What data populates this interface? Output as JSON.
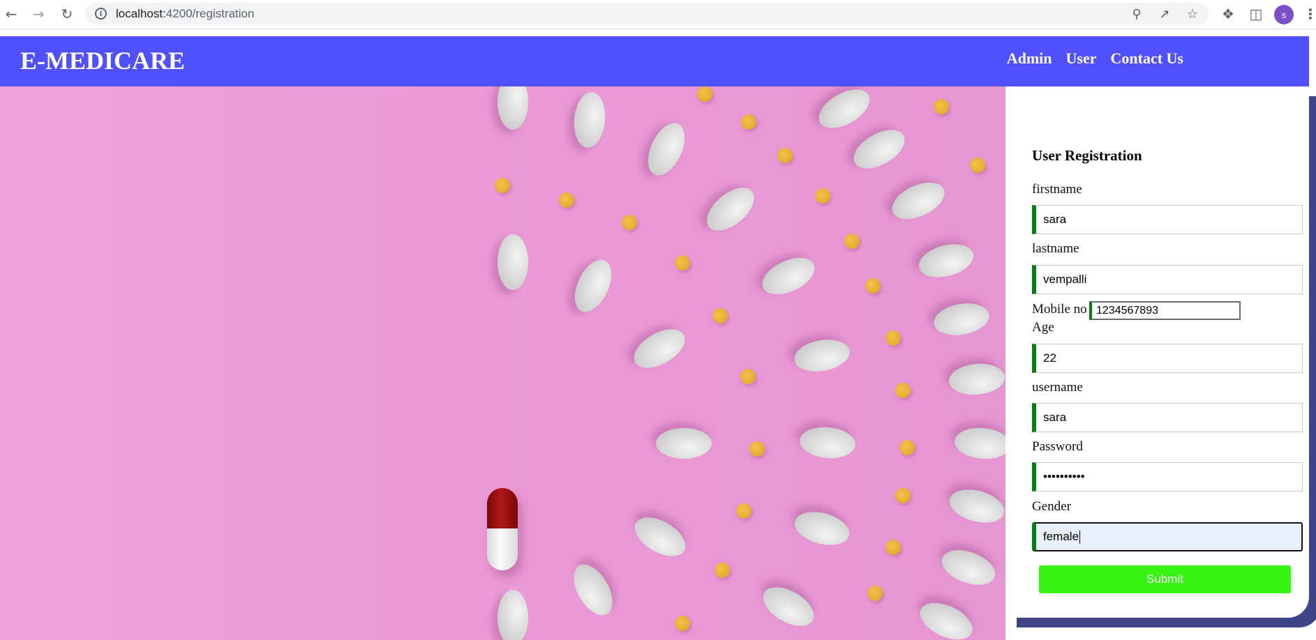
{
  "browser": {
    "url_host": "localhost:",
    "url_rest": "4200/registration",
    "profile_initial": "s",
    "icons": {
      "back": "arrow-left-icon",
      "forward": "arrow-right-icon",
      "reload": "reload-icon",
      "site_info": "info-icon",
      "password": "key-icon",
      "share": "share-icon",
      "bookmark": "star-icon",
      "extensions": "puzzle-icon",
      "side_panel": "side-panel-icon",
      "menu": "more-vert-icon"
    }
  },
  "header": {
    "brand": "E-MEDICARE",
    "nav": [
      "Admin",
      "User",
      "Contact Us"
    ]
  },
  "form": {
    "title": "User Registration",
    "firstname_label": "firstname",
    "firstname_value": "sara",
    "lastname_label": "lastname",
    "lastname_value": "vempalli",
    "mobile_label": "Mobile no",
    "mobile_value": "1234567893",
    "age_label": "Age",
    "age_value": "22",
    "username_label": "username",
    "username_value": "sara",
    "password_label": "Password",
    "password_value": "••••••••••",
    "gender_label": "Gender",
    "gender_value": "female",
    "submit_label": "Submit"
  },
  "colors": {
    "header_bg": "#5050ff",
    "hero_pink": "#eb9ad7",
    "field_accent": "#0b7a16",
    "submit_bg": "#37f312",
    "card_shadow": "#3d4488"
  }
}
